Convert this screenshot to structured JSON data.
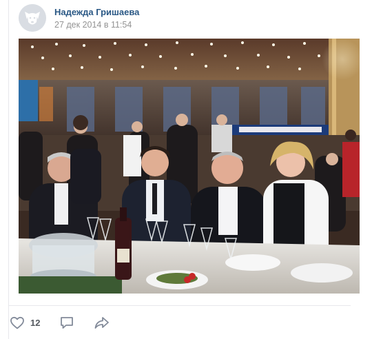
{
  "post": {
    "author_name": "Надежда Гришаева",
    "date": "27 дек 2014 в 11:54",
    "avatar_icon": "deactivated-dog-avatar-icon",
    "photo_description_icon": "post-photo"
  },
  "actions": {
    "like_icon": "heart-icon",
    "like_count": "12",
    "comment_icon": "comment-icon",
    "share_icon": "share-arrow-icon"
  },
  "colors": {
    "link": "#2a5885",
    "meta": "#939393",
    "action_icon": "#828a99",
    "divider": "#e7e8ec"
  }
}
